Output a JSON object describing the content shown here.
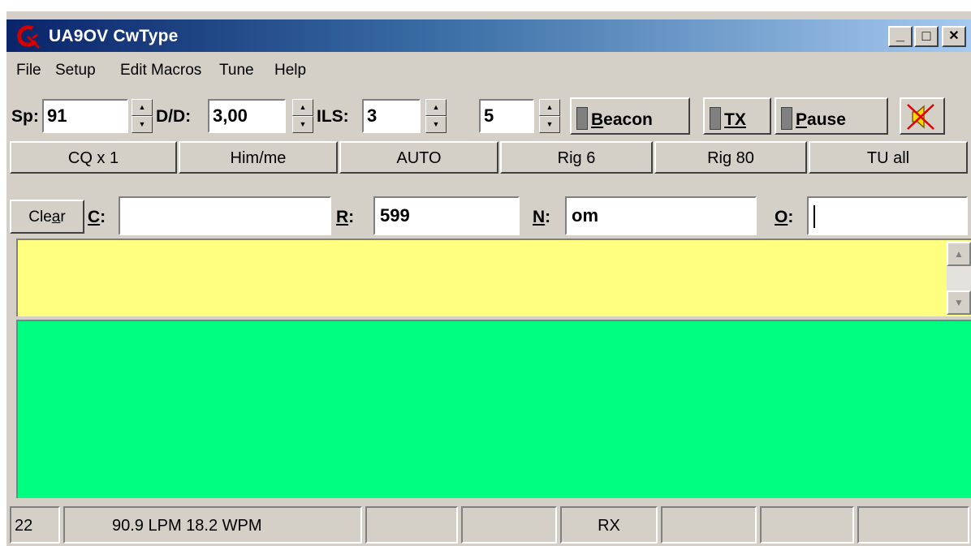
{
  "window": {
    "title": "UA9OV CwType",
    "controls": {
      "minimize": "_",
      "maximize": "□",
      "close": "✕"
    }
  },
  "menu": [
    "File",
    "Setup",
    "Edit Macros",
    "Tune",
    "Help"
  ],
  "toolbar": {
    "speed_label": "Sp:",
    "speed_value": "91",
    "dd_label": "D/D:",
    "dd_value": "3,00",
    "ils_label": "ILS:",
    "ils_value": "3",
    "extra_value": "5",
    "beacon_label_key": "B",
    "beacon_label_rest": "eacon",
    "tx_label": "TX",
    "pause_label_key": "P",
    "pause_label_rest": "ause",
    "speaker_icon": "speaker-muted-icon"
  },
  "macros": [
    "CQ x 1",
    "Him/me",
    "AUTO",
    "Rig 6",
    "Rig 80",
    "TU all"
  ],
  "fields": {
    "clear_label_a": "Cle",
    "clear_label_key": "a",
    "clear_label_b": "r",
    "call_label_key": "C",
    "call_value": "",
    "rst_label_key": "R",
    "rst_value": "599",
    "name_label_key": "N",
    "name_value": "om",
    "other_label_key": "O",
    "other_value": ""
  },
  "colors": {
    "tx_area": "#ffff80",
    "rx_area": "#00ff80",
    "titlebar_start": "#0a246a",
    "titlebar_end": "#a6caf0"
  },
  "status": {
    "count": "22",
    "speed_text": "90.9 LPM  18.2 WPM",
    "p3": "",
    "p4": "",
    "mode": "RX",
    "p6": "",
    "p7": "",
    "p8": ""
  }
}
